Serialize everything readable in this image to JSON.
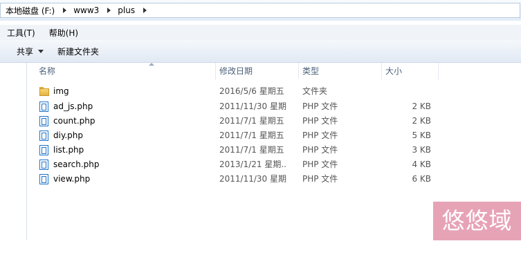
{
  "address": {
    "crumbs": [
      "本地磁盘 (F:)",
      "www3",
      "plus"
    ]
  },
  "menu": {
    "items": [
      "工具(T)",
      "帮助(H)"
    ]
  },
  "toolbar": {
    "share": "共享",
    "new_folder": "新建文件夹"
  },
  "columns": {
    "name": "名称",
    "date": "修改日期",
    "type": "类型",
    "size": "大小"
  },
  "files": [
    {
      "name": "img",
      "date": "2016/5/6 星期五 ...",
      "type": "文件夹",
      "size": "",
      "icon": "folder-icon"
    },
    {
      "name": "ad_js.php",
      "date": "2011/11/30 星期...",
      "type": "PHP 文件",
      "size": "2 KB",
      "icon": "php-file-icon"
    },
    {
      "name": "count.php",
      "date": "2011/7/1 星期五 ...",
      "type": "PHP 文件",
      "size": "2 KB",
      "icon": "php-file-icon"
    },
    {
      "name": "diy.php",
      "date": "2011/7/1 星期五 ...",
      "type": "PHP 文件",
      "size": "5 KB",
      "icon": "php-file-icon"
    },
    {
      "name": "list.php",
      "date": "2011/7/1 星期五 ...",
      "type": "PHP 文件",
      "size": "3 KB",
      "icon": "php-file-icon"
    },
    {
      "name": "search.php",
      "date": "2013/1/21 星期...",
      "type": "PHP 文件",
      "size": "4 KB",
      "icon": "php-file-icon"
    },
    {
      "name": "view.php",
      "date": "2011/11/30 星期...",
      "type": "PHP 文件",
      "size": "6 KB",
      "icon": "php-file-icon"
    }
  ],
  "watermark": "悠悠域名",
  "colors": {
    "accent": "#1b72c9",
    "watermark_bg": "#e7a3b6"
  }
}
